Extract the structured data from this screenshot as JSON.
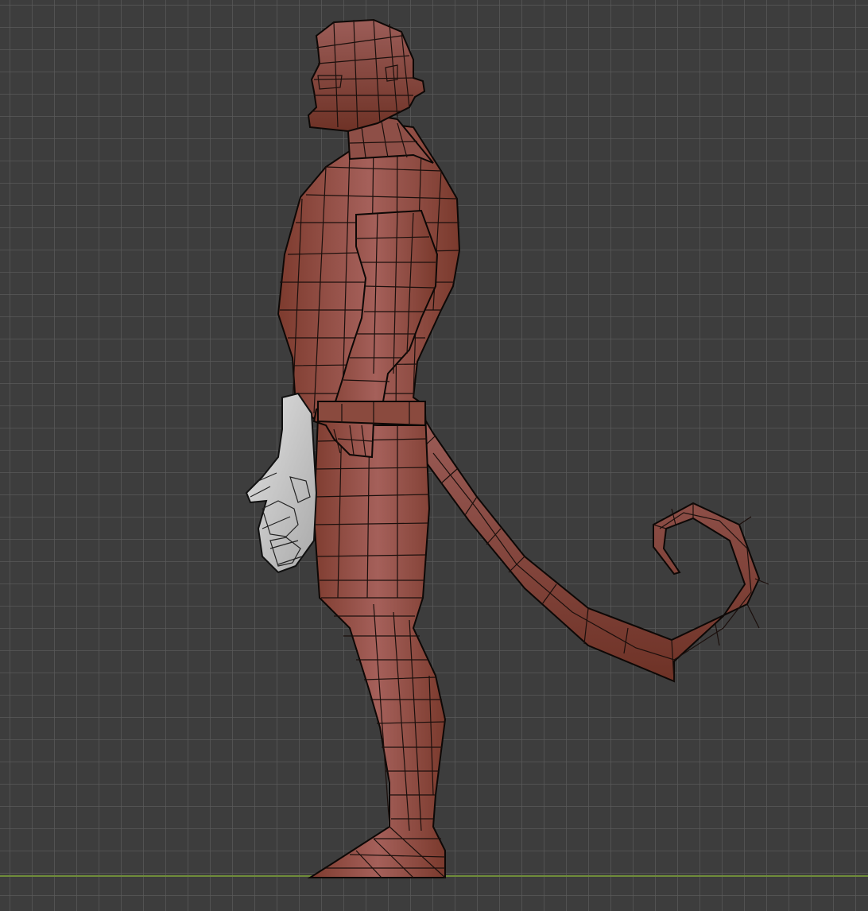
{
  "viewport": {
    "view": "side-orthographic",
    "background_color": "#3d3d3d",
    "grid_color": "#5a5a5a",
    "ground_axis_color": "#6f8c3a"
  },
  "model": {
    "object": "character-mesh",
    "display": "wireframe-over-solid",
    "body_color": "#8f4a3c",
    "highlight_color": "#b07066",
    "right_hand_color": "#d2d2d2"
  }
}
